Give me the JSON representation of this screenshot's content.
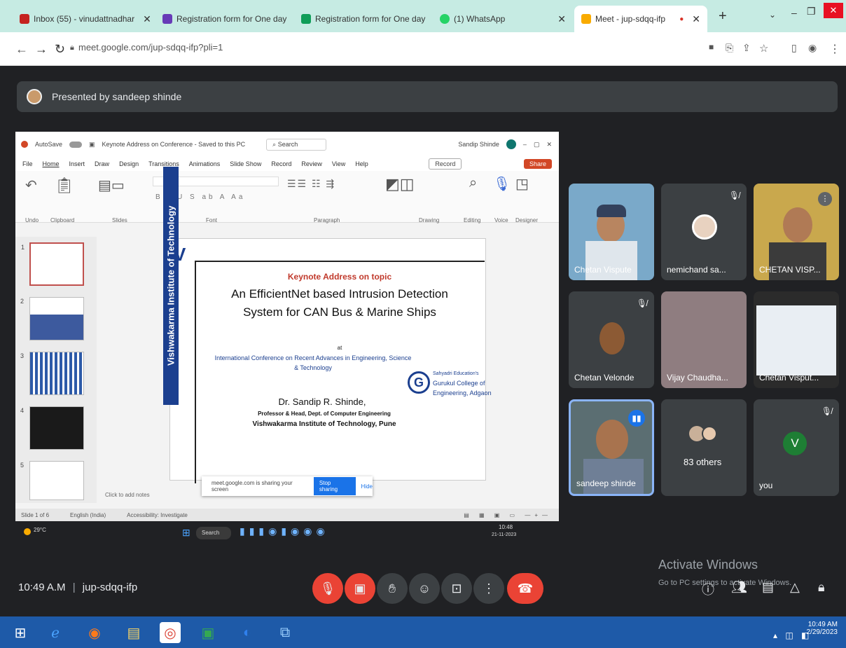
{
  "browser": {
    "tabs": [
      {
        "label": "Inbox (55) - vinudattnadhar",
        "color": "#c5221f"
      },
      {
        "label": "Registration form for One day",
        "color": "#673ab7"
      },
      {
        "label": "Registration form for One day",
        "color": "#0f9d58"
      },
      {
        "label": "(1) WhatsApp",
        "color": "#25d366"
      },
      {
        "label": "Meet - jup-sdqq-ifp",
        "color": "#f9ab00"
      }
    ],
    "new_tab": "+",
    "url": "meet.google.com/jup-sdqq-ifp?pli=1"
  },
  "meet": {
    "presenting_text": "Presented by sandeep shinde",
    "meeting_time": "10:49 A.M",
    "meeting_code": "jup-sdqq-ifp",
    "participants": [
      {
        "name": "Chetan Vispute"
      },
      {
        "name": "nemichand sa..."
      },
      {
        "name": "CHETAN VISP..."
      },
      {
        "name": "Chetan Velonde"
      },
      {
        "name": "Vijay Chaudha..."
      },
      {
        "name": "Chetan Visput..."
      },
      {
        "name": "sandeep shinde"
      },
      {
        "name": "83 others"
      },
      {
        "name": "you",
        "initial": "V"
      }
    ],
    "activate_windows": "Activate Windows",
    "activate_sub": "Go to PC settings to activate Windows."
  },
  "ppt": {
    "autosave": "AutoSave",
    "doc_title": "Keynote Address on Conference - Saved to this PC",
    "search": "Search",
    "user": "Sandip Shinde",
    "menus": [
      "File",
      "Home",
      "Insert",
      "Draw",
      "Design",
      "Transitions",
      "Animations",
      "Slide Show",
      "Record",
      "Review",
      "View",
      "Help"
    ],
    "record_btn": "Record",
    "share_btn": "Share",
    "groups": [
      "Undo",
      "Clipboard",
      "Slides",
      "Font",
      "Paragraph",
      "Drawing",
      "Editing",
      "Voice",
      "Designer"
    ],
    "thumbs": [
      "1",
      "2",
      "3",
      "4",
      "5"
    ],
    "click_notes": "Click to add notes",
    "status": [
      "Slide 1 of 6",
      "English (India)",
      "Accessibility: Investigate"
    ],
    "notes_tip": "meet.google.com is sharing your screen",
    "stop_sharing": "Stop sharing",
    "hide": "Hide"
  },
  "slide": {
    "vertical_text": "Vishwakarma Institute of Technology",
    "heading": "Keynote Address on topic",
    "title_line1": "An EfficientNet based Intrusion Detection",
    "title_line2": "System for CAN Bus & Marine Ships",
    "at": "at",
    "conf_line1": "International Conference on Recent Advances in Engineering, Science",
    "conf_line2": "& Technology",
    "college1": "Sahyadri Education's",
    "college2": "Gurukul College of",
    "college3": "Engineering, Adgaon",
    "speaker": "Dr. Sandip R. Shinde,",
    "role": "Professor & Head, Dept. of Computer Engineering",
    "inst": "Vishwakarma Institute of Technology, Pune"
  },
  "shared_taskbar": {
    "weather": "29°C",
    "search": "Search",
    "time": "10:48",
    "date": "21-11-2023"
  },
  "win_taskbar": {
    "time": "10:49 AM",
    "date": "2/29/2023"
  },
  "colors": {
    "meet_bg": "#202124",
    "tile_bg": "#3c4043",
    "red": "#ea4335",
    "vit_blue": "#1b3f8f"
  }
}
